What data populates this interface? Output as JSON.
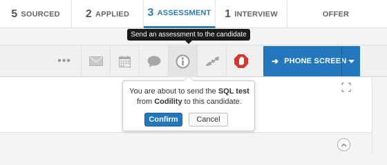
{
  "stages": [
    {
      "count": "5",
      "label": "SOURCED"
    },
    {
      "count": "2",
      "label": "APPLIED"
    },
    {
      "count": "3",
      "label": "ASSESSMENT"
    },
    {
      "count": "1",
      "label": "INTERVIEW"
    },
    {
      "count": "",
      "label": "OFFER"
    }
  ],
  "active_stage": "ASSESSMENT",
  "tooltip": "Send an assessment to the candidate",
  "toolbar": {
    "more": "•••",
    "primary_action": "PHONE SCREEN"
  },
  "popover": {
    "text_1": "You are about to send the ",
    "test_name": "SQL test",
    "text_2": "from ",
    "provider": "Codility",
    "text_3": " to this candidate.",
    "confirm_label": "Confirm",
    "cancel_label": "Cancel"
  },
  "colors": {
    "accent": "#2377bd",
    "active_stage": "#2a7ab8",
    "stop_red": "#d9352b",
    "tooltip_bg": "#1a1a1a"
  },
  "icons": [
    "more-icon",
    "envelope-icon",
    "calendar-icon",
    "chat-bubble-icon",
    "assessment-icon",
    "handoff-icon",
    "stop-hand-icon",
    "arrow-right-icon",
    "caret-down-icon",
    "expand-icon",
    "collapse-up-icon"
  ]
}
